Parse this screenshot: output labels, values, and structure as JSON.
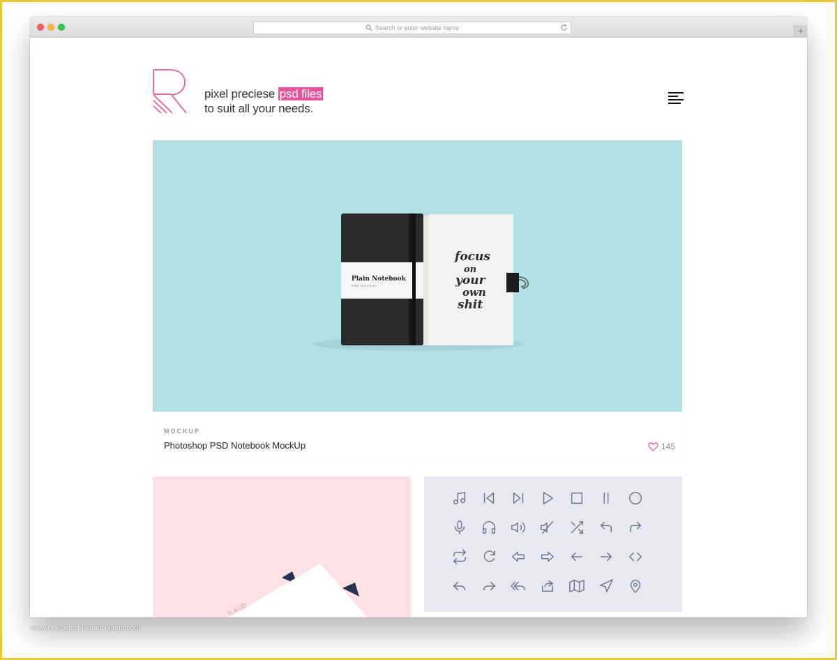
{
  "browser": {
    "url_placeholder": "Search or enter website name",
    "newtab_label": "+"
  },
  "header": {
    "tagline_line1_plain": "pixel preciese ",
    "tagline_line1_highlight": "psd files",
    "tagline_line2": "to suit all your needs.",
    "accent_color": "#e5539a"
  },
  "hero": {
    "notebook_cover_title": "Plain Notebook",
    "notebook_cover_sub": "PSD MOCKUP",
    "page_lettering": [
      "focus",
      "on",
      "your",
      "own",
      "shit"
    ],
    "background_color": "#b1e1e5"
  },
  "card": {
    "category": "MOCKUP",
    "title": "Photoshop PSD Notebook MockUp",
    "likes": "145"
  },
  "pink_card": {
    "card_text": "h Kob",
    "background_color": "#fde1e6"
  },
  "icons_card": {
    "background_color": "#e7e8f3",
    "icons": [
      "music-note-icon",
      "skip-back-icon",
      "skip-forward-icon",
      "play-icon",
      "stop-icon",
      "pause-icon",
      "record-icon",
      "microphone-icon",
      "headphones-icon",
      "volume-icon",
      "mute-icon",
      "shuffle-icon",
      "undo-icon",
      "redo-icon",
      "repeat-icon",
      "refresh-icon",
      "arrow-left-outline-icon",
      "arrow-right-outline-icon",
      "arrow-left-icon",
      "arrow-right-icon",
      "code-icon",
      "reply-icon",
      "forward-icon",
      "reply-all-icon",
      "share-icon",
      "map-icon",
      "navigation-icon",
      "location-pin-icon"
    ]
  },
  "watermark": "www.heritagechristiancollege.com"
}
